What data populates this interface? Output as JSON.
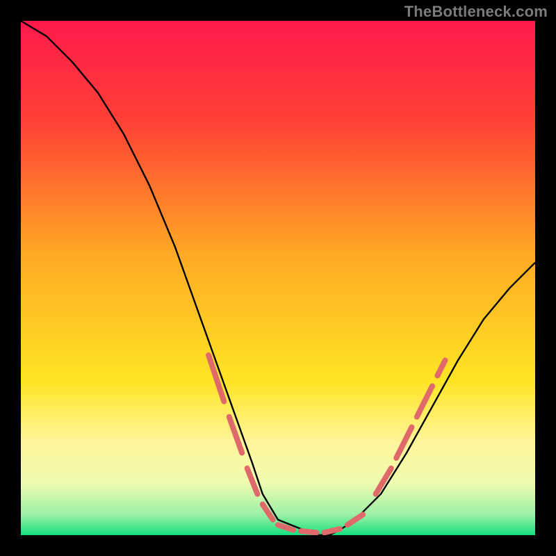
{
  "attribution": "TheBottleneck.com",
  "chart_data": {
    "type": "line",
    "title": "",
    "xlabel": "",
    "ylabel": "",
    "xlim": [
      0,
      100
    ],
    "ylim": [
      0,
      100
    ],
    "gradient_stops": [
      {
        "offset": 0,
        "color": "#ff1a4b"
      },
      {
        "offset": 20,
        "color": "#ff4235"
      },
      {
        "offset": 45,
        "color": "#ffa824"
      },
      {
        "offset": 70,
        "color": "#ffe524"
      },
      {
        "offset": 82,
        "color": "#fff59b"
      },
      {
        "offset": 90,
        "color": "#eefcb0"
      },
      {
        "offset": 96,
        "color": "#9cf0a6"
      },
      {
        "offset": 100,
        "color": "#17e07e"
      }
    ],
    "series": [
      {
        "name": "bottleneck-curve",
        "color": "#000000",
        "x": [
          0,
          5,
          10,
          15,
          20,
          25,
          30,
          35,
          40,
          45,
          47,
          50,
          55,
          58,
          60,
          62,
          65,
          70,
          75,
          80,
          85,
          90,
          95,
          100
        ],
        "y": [
          100,
          97,
          92,
          86,
          78,
          68,
          56,
          42,
          28,
          14,
          8,
          3,
          1,
          0,
          0,
          1,
          3,
          8,
          16,
          25,
          34,
          42,
          48,
          53
        ]
      }
    ],
    "dash_segments": {
      "color": "#e06a6a",
      "stroke_width": 8,
      "segments": [
        {
          "x1": 36.5,
          "y1": 35,
          "x2": 39.5,
          "y2": 26
        },
        {
          "x1": 40.5,
          "y1": 23,
          "x2": 43.0,
          "y2": 16
        },
        {
          "x1": 44.0,
          "y1": 13,
          "x2": 46.0,
          "y2": 8
        },
        {
          "x1": 47.0,
          "y1": 6,
          "x2": 49.0,
          "y2": 3
        },
        {
          "x1": 50.0,
          "y1": 2,
          "x2": 53.0,
          "y2": 1
        },
        {
          "x1": 54.5,
          "y1": 0.8,
          "x2": 57.5,
          "y2": 0.5
        },
        {
          "x1": 59.0,
          "y1": 0.5,
          "x2": 62.0,
          "y2": 1.2
        },
        {
          "x1": 63.5,
          "y1": 2,
          "x2": 66.5,
          "y2": 4
        },
        {
          "x1": 69.0,
          "y1": 8,
          "x2": 72.0,
          "y2": 13
        },
        {
          "x1": 73.0,
          "y1": 15,
          "x2": 76.0,
          "y2": 21
        },
        {
          "x1": 77.0,
          "y1": 23,
          "x2": 80.0,
          "y2": 29
        },
        {
          "x1": 81.0,
          "y1": 31,
          "x2": 82.5,
          "y2": 34
        }
      ]
    }
  }
}
